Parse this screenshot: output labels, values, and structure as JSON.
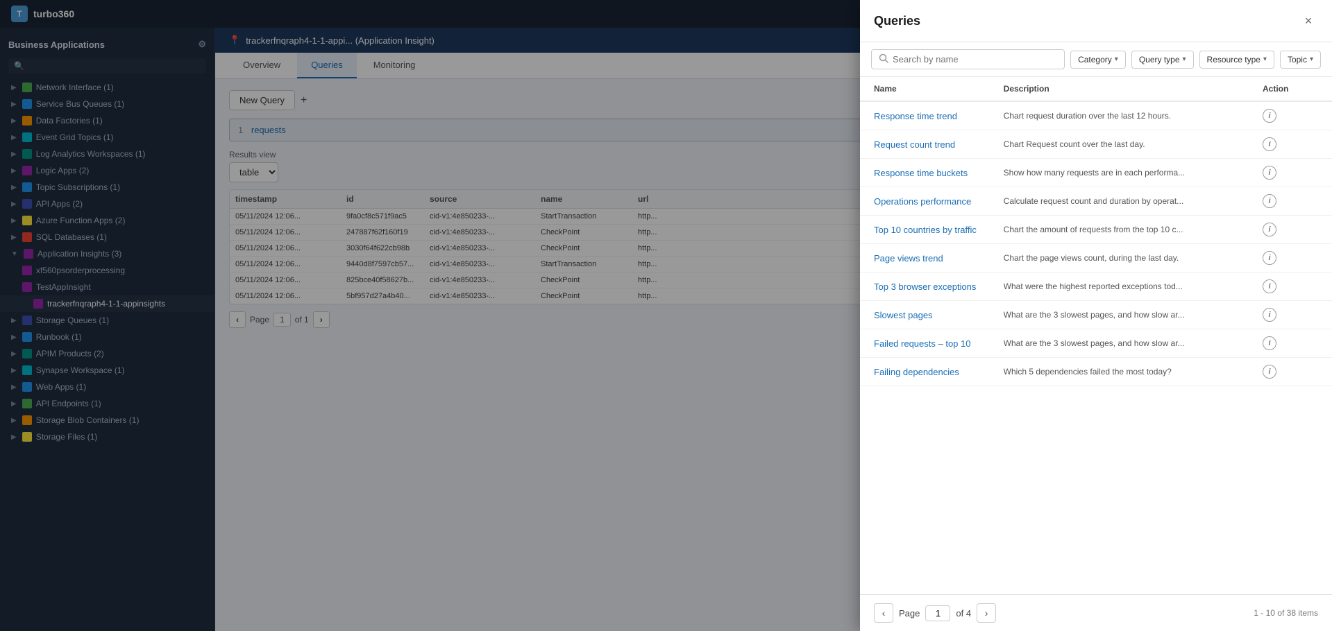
{
  "app": {
    "name": "turbo360"
  },
  "topbar": {
    "logo_text": "turbo360"
  },
  "sidebar": {
    "header": "Business Applications",
    "items": [
      {
        "id": "network-interface",
        "label": "Network Interface (1)",
        "icon": "icon-green",
        "level": 0,
        "expanded": false
      },
      {
        "id": "service-bus-queues",
        "label": "Service Bus Queues (1)",
        "icon": "icon-blue",
        "level": 0,
        "expanded": false
      },
      {
        "id": "data-factories",
        "label": "Data Factories (1)",
        "icon": "icon-orange",
        "level": 0,
        "expanded": false
      },
      {
        "id": "event-grid-topics",
        "label": "Event Grid Topics (1)",
        "icon": "icon-cyan",
        "level": 0,
        "expanded": false
      },
      {
        "id": "log-analytics",
        "label": "Log Analytics Workspaces (1)",
        "icon": "icon-teal",
        "level": 0,
        "expanded": false
      },
      {
        "id": "logic-apps",
        "label": "Logic Apps (2)",
        "icon": "icon-purple",
        "level": 0,
        "expanded": false
      },
      {
        "id": "topic-subscriptions",
        "label": "Topic Subscriptions (1)",
        "icon": "icon-blue",
        "level": 0,
        "expanded": false
      },
      {
        "id": "api-apps",
        "label": "API Apps (2)",
        "icon": "icon-darkblue",
        "level": 0,
        "expanded": false
      },
      {
        "id": "azure-function-apps",
        "label": "Azure Function Apps (2)",
        "icon": "icon-yellow",
        "level": 0,
        "expanded": false
      },
      {
        "id": "sql-databases",
        "label": "SQL Databases (1)",
        "icon": "icon-red",
        "level": 0,
        "expanded": false
      },
      {
        "id": "application-insights",
        "label": "Application Insights (3)",
        "icon": "icon-purple",
        "level": 0,
        "expanded": true
      },
      {
        "id": "ai-child1",
        "label": "xf560psorderprocessing",
        "icon": "icon-purple",
        "level": 1
      },
      {
        "id": "ai-child2",
        "label": "TestAppInsight",
        "icon": "icon-purple",
        "level": 1
      },
      {
        "id": "ai-child3",
        "label": "trackerfnqraph4-1-1-appinsights",
        "icon": "icon-purple",
        "level": 2,
        "active": true
      },
      {
        "id": "storage-queues",
        "label": "Storage Queues (1)",
        "icon": "icon-darkblue",
        "level": 0,
        "expanded": false
      },
      {
        "id": "runbook",
        "label": "Runbook (1)",
        "icon": "icon-blue",
        "level": 0,
        "expanded": false
      },
      {
        "id": "apim-products",
        "label": "APIM Products (2)",
        "icon": "icon-teal",
        "level": 0,
        "expanded": false
      },
      {
        "id": "synapse-workspace",
        "label": "Synapse Workspace (1)",
        "icon": "icon-cyan",
        "level": 0,
        "expanded": false
      },
      {
        "id": "web-apps",
        "label": "Web Apps (1)",
        "icon": "icon-blue",
        "level": 0,
        "expanded": false
      },
      {
        "id": "api-endpoints",
        "label": "API Endpoints (1)",
        "icon": "icon-green",
        "level": 0,
        "expanded": false
      },
      {
        "id": "storage-blob",
        "label": "Storage Blob Containers (1)",
        "icon": "icon-orange",
        "level": 0,
        "expanded": false
      },
      {
        "id": "storage-files",
        "label": "Storage Files (1)",
        "icon": "icon-yellow",
        "level": 0,
        "expanded": false
      }
    ]
  },
  "main": {
    "breadcrumb": "trackerfnqraph4-1-1-appi... (Application Insight)",
    "tabs": [
      {
        "id": "overview",
        "label": "Overview"
      },
      {
        "id": "queries",
        "label": "Queries"
      },
      {
        "id": "monitoring",
        "label": "Monitoring"
      }
    ],
    "active_tab": "Queries",
    "new_query_label": "New Query",
    "query_input_value": "requests",
    "results_view_label": "Results view",
    "results_view_value": "table",
    "table": {
      "headers": [
        "timestamp",
        "id",
        "source",
        "name",
        "url"
      ],
      "rows": [
        [
          "05/11/2024 12:06...",
          "9fa0cf8c571f9ac5",
          "cid-v1:4e850233-...",
          "StartTransaction",
          "http..."
        ],
        [
          "05/11/2024 12:06...",
          "247887f62f160f19",
          "cid-v1:4e850233-...",
          "CheckPoint",
          "http..."
        ],
        [
          "05/11/2024 12:06...",
          "3030f64f622cb98b",
          "cid-v1:4e850233-...",
          "CheckPoint",
          "http..."
        ],
        [
          "05/11/2024 12:06...",
          "9440d8f7597cb57...",
          "cid-v1:4e850233-...",
          "StartTransaction",
          "http..."
        ],
        [
          "05/11/2024 12:06...",
          "825bce40f58627b...",
          "cid-v1:4e850233-...",
          "CheckPoint",
          "http..."
        ],
        [
          "05/11/2024 12:06...",
          "5bf957d27a4b40...",
          "cid-v1:4e850233-...",
          "CheckPoint",
          "http..."
        ]
      ]
    },
    "pagination": {
      "page_label": "Page",
      "current": "1",
      "of_label": "of 1"
    }
  },
  "modal": {
    "title": "Queries",
    "close_label": "×",
    "search_placeholder": "Search by name",
    "filters": [
      {
        "id": "category",
        "label": "Category"
      },
      {
        "id": "query-type",
        "label": "Query type"
      },
      {
        "id": "resource-type",
        "label": "Resource type"
      },
      {
        "id": "topic",
        "label": "Topic"
      }
    ],
    "table": {
      "headers": {
        "name": "Name",
        "description": "Description",
        "action": "Action"
      },
      "rows": [
        {
          "name": "Response time trend",
          "description": "Chart request duration over the last 12 hours."
        },
        {
          "name": "Request count trend",
          "description": "Chart Request count over the last day."
        },
        {
          "name": "Response time buckets",
          "description": "Show how many requests are in each performa..."
        },
        {
          "name": "Operations performance",
          "description": "Calculate request count and duration by operat..."
        },
        {
          "name": "Top 10 countries by traffic",
          "description": "Chart the amount of requests from the top 10 c..."
        },
        {
          "name": "Page views trend",
          "description": "Chart the page views count, during the last day."
        },
        {
          "name": "Top 3 browser exceptions",
          "description": "What were the highest reported exceptions tod..."
        },
        {
          "name": "Slowest pages",
          "description": "What are the 3 slowest pages, and how slow ar..."
        },
        {
          "name": "Failed requests – top 10",
          "description": "What are the 3 slowest pages, and how slow ar..."
        },
        {
          "name": "Failing dependencies",
          "description": "Which 5 dependencies failed the most today?"
        }
      ]
    },
    "pagination": {
      "page_label": "Page",
      "current": "1",
      "of_label": "of 4",
      "total_label": "1 - 10 of 38 items"
    }
  }
}
